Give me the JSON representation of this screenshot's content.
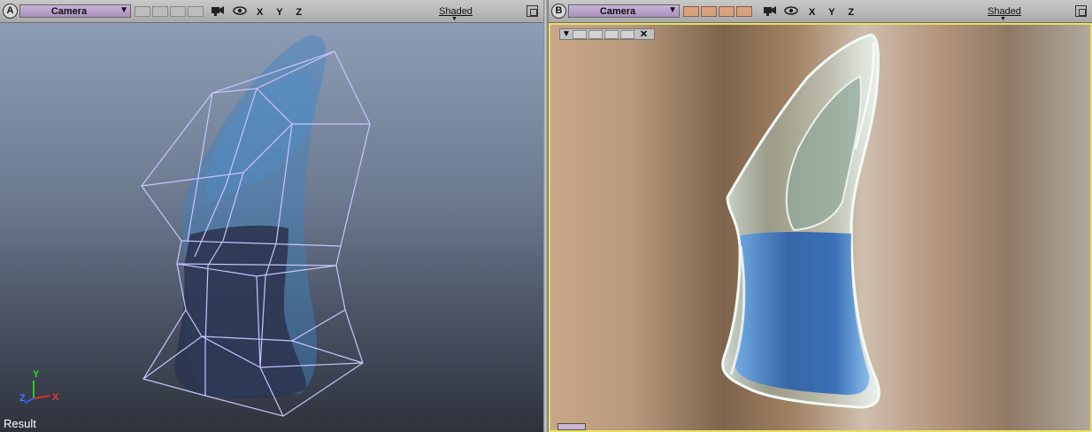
{
  "viewportA": {
    "letter": "A",
    "camera": "Camera",
    "axes": "X Y Z",
    "shading": "Shaded",
    "status": "Result",
    "gizmo": {
      "y": "Y",
      "z": "Z",
      "x": "X"
    }
  },
  "viewportB": {
    "letter": "B",
    "camera": "Camera",
    "axes": "X Y Z",
    "shading": "Shaded"
  },
  "colors": {
    "camera_select": "#b69fca",
    "render_border": "#e8e060",
    "wireframe": "#c9c4ff",
    "liquid": "#2f76c6"
  },
  "icons": [
    "viewport-letter-icon",
    "camera-icon",
    "eye-icon",
    "maximize-icon",
    "dropdown-arrow-icon",
    "close-icon"
  ]
}
